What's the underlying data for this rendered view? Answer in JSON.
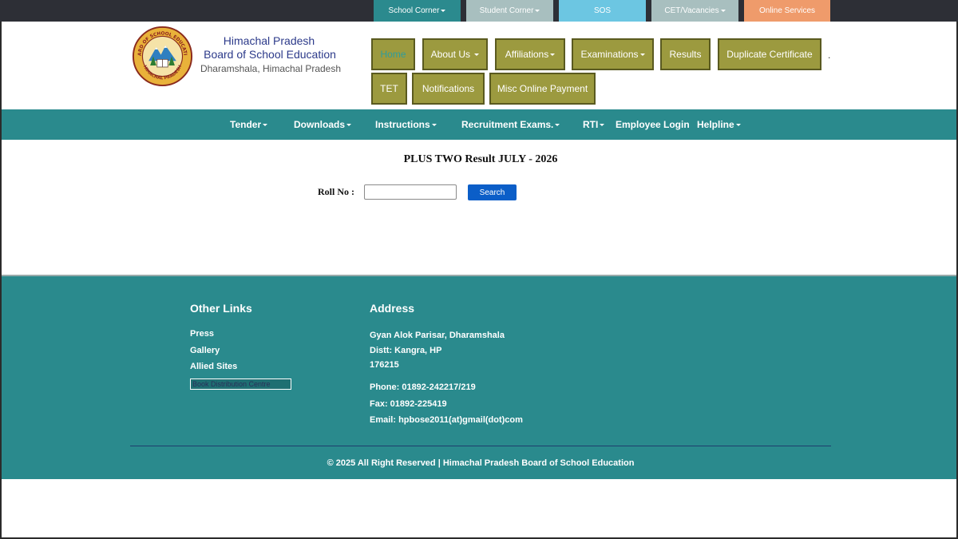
{
  "topbar": {
    "items": [
      {
        "label": "School Corner",
        "color": "#2b8a8e"
      },
      {
        "label": "Student Corner",
        "color": "#a8bfbf"
      },
      {
        "label": "SOS",
        "color": "#6cc6e2"
      },
      {
        "label": "CET/Vacancies",
        "color": "#a8bfbf"
      },
      {
        "label": "Online Services",
        "color": "#ef9b6b"
      }
    ]
  },
  "header": {
    "org_line1": "Himachal Pradesh",
    "org_line2": "Board of School Education",
    "location": "Dharamshala, Himachal Pradesh",
    "logo_text_top": "BOARD OF SCHOOL EDUCATION",
    "logo_text_bottom": "HIMACHAL PRADESH"
  },
  "nav": {
    "items": [
      "Home",
      "About Us",
      "Affiliations",
      "Examinations",
      "Results",
      "Duplicate Certificate",
      "TET",
      "Notifications",
      "Misc Online Payment"
    ],
    "dot": "."
  },
  "nav2": {
    "items": [
      "Tender",
      "Downloads",
      "Instructions",
      "Recruitment Exams.",
      "RTI",
      "Employee Login",
      "Helpline"
    ]
  },
  "main": {
    "title": "PLUS TWO Result JULY - 2026",
    "roll_label": "Roll No :",
    "roll_value": "",
    "search_label": "Search"
  },
  "footer": {
    "other_links_heading": "Other Links",
    "links": [
      "Press",
      "Gallery",
      "Allied Sites",
      "Book Distribution Centre"
    ],
    "address_heading": "Address",
    "address_lines": [
      "Gyan Alok Parisar, Dharamshala",
      "Distt: Kangra, HP",
      "176215"
    ],
    "phone": "Phone: 01892-242217/219",
    "fax": "Fax: 01892-225419",
    "email": "Email: hpbose2011(at)gmail(dot)com",
    "copyright": "© 2025 All Right Reserved | Himachal Pradesh Board of School Education"
  }
}
